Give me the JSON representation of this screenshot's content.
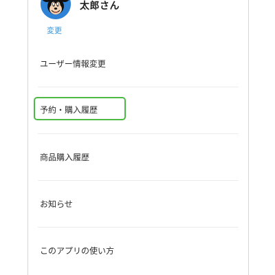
{
  "profile": {
    "name": "太郎さん",
    "change_label": "変更",
    "avatar_icon": "mouse-character-avatar"
  },
  "menu": {
    "items": [
      {
        "label": "ユーザー情報変更"
      },
      {
        "label": "予約・購入履歴",
        "highlighted": true
      },
      {
        "label": "商品購入履歴"
      },
      {
        "label": "お知らせ"
      },
      {
        "label": "このアプリの使い方"
      }
    ]
  },
  "colors": {
    "accent": "#3d95d9",
    "highlight": "#4cb944",
    "avatar_bg": "#2f83d6"
  }
}
